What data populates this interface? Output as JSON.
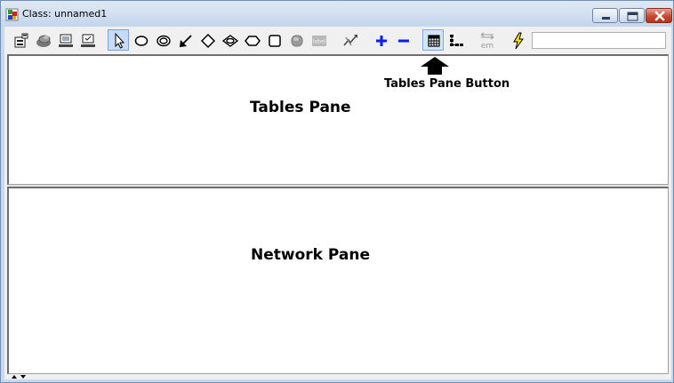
{
  "window": {
    "title": "Class: unnamed1",
    "app_icon": "class-cube-icon",
    "buttons": [
      "minimize-icon",
      "maximize-icon",
      "close-icon"
    ]
  },
  "toolbar": {
    "tools": [
      {
        "name": "properties-tool",
        "icon": "properties-icon"
      },
      {
        "name": "open-tool",
        "icon": "stacked-disks-icon"
      },
      {
        "name": "monitor-tool",
        "icon": "monitor-icon"
      },
      {
        "name": "monitor-tool-2",
        "icon": "monitor-icon"
      },
      {
        "name": "select-tool",
        "icon": "pointer-icon",
        "state": "pressed"
      },
      {
        "name": "ellipse-node-tool",
        "icon": "ellipse-icon"
      },
      {
        "name": "double-ellipse-node-tool",
        "icon": "double-ellipse-icon"
      },
      {
        "name": "arc-tool",
        "icon": "arrow-icon"
      },
      {
        "name": "diamond-node-tool",
        "icon": "diamond-icon"
      },
      {
        "name": "double-diamond-node-tool",
        "icon": "eye-shape-icon"
      },
      {
        "name": "hexagon-node-tool",
        "icon": "hexagon-icon"
      },
      {
        "name": "rectangle-node-tool",
        "icon": "rounded-square-icon"
      },
      {
        "name": "grey-node-tool",
        "icon": "grey-blob-icon",
        "state": "disabled"
      },
      {
        "name": "label-tool",
        "icon": "label-icon",
        "state": "disabled"
      },
      {
        "name": "compile-tool",
        "icon": "lightning-arrow-icon"
      },
      {
        "name": "expand-tool",
        "icon": "plus-icon"
      },
      {
        "name": "collapse-tool",
        "icon": "minus-icon"
      },
      {
        "name": "tables-pane-button",
        "icon": "grid-icon",
        "state": "hot"
      },
      {
        "name": "tree-pane-button",
        "icon": "tree-icon"
      },
      {
        "name": "em-tool",
        "icon": "em-arrows-icon",
        "state": "disabled"
      },
      {
        "name": "run-tool",
        "icon": "lightning-icon"
      }
    ],
    "label_icon_text": "label",
    "em_icon_text": "em",
    "search_value": "",
    "accent_color": "#0a1ef0"
  },
  "annotation": {
    "text": "Tables Pane Button",
    "arrow_icon": "up-arrow-icon"
  },
  "panes": {
    "tables_label": "Tables Pane",
    "network_label": "Network Pane"
  }
}
